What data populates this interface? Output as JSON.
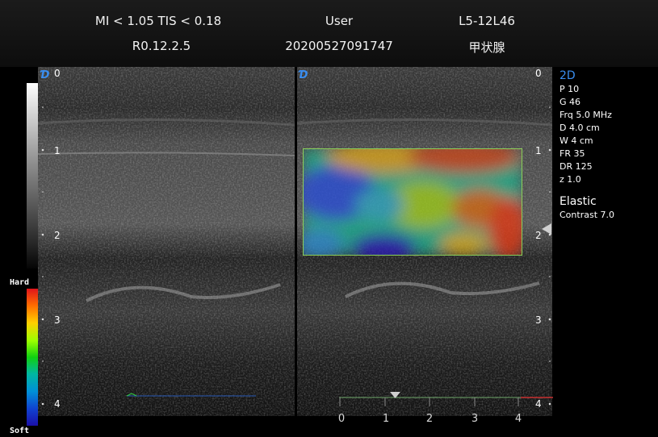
{
  "header": {
    "mi_tis": "MI < 1.05  TIS < 0.18",
    "user": "User",
    "probe": "L5-12L46",
    "version": "R0.12.2.5",
    "study_id": "20200527091747",
    "preset": "甲状腺"
  },
  "colorbar": {
    "hard_label": "Hard",
    "soft_label": "Soft"
  },
  "depth_labels_left": [
    "0",
    "1",
    "2",
    "3",
    "4"
  ],
  "depth_labels_right": [
    "0",
    "1",
    "2",
    "3",
    "4"
  ],
  "logo_glyph": "Ɗ",
  "params": {
    "mode": "2D",
    "p": "P  10",
    "g": "G  46",
    "frq": "Frq  5.0  MHz",
    "d": "D  4.0  cm",
    "w": "W   4  cm",
    "fr": "FR  35",
    "dr": "DR  125",
    "z": "z  1.0",
    "elastic": "Elastic",
    "contrast": "Contrast  7.0"
  },
  "scale_labels": [
    "0",
    "1",
    "2",
    "3",
    "4"
  ],
  "colors": {
    "accent_blue": "#3a8ef0",
    "roi_border": "#8bd05a"
  }
}
